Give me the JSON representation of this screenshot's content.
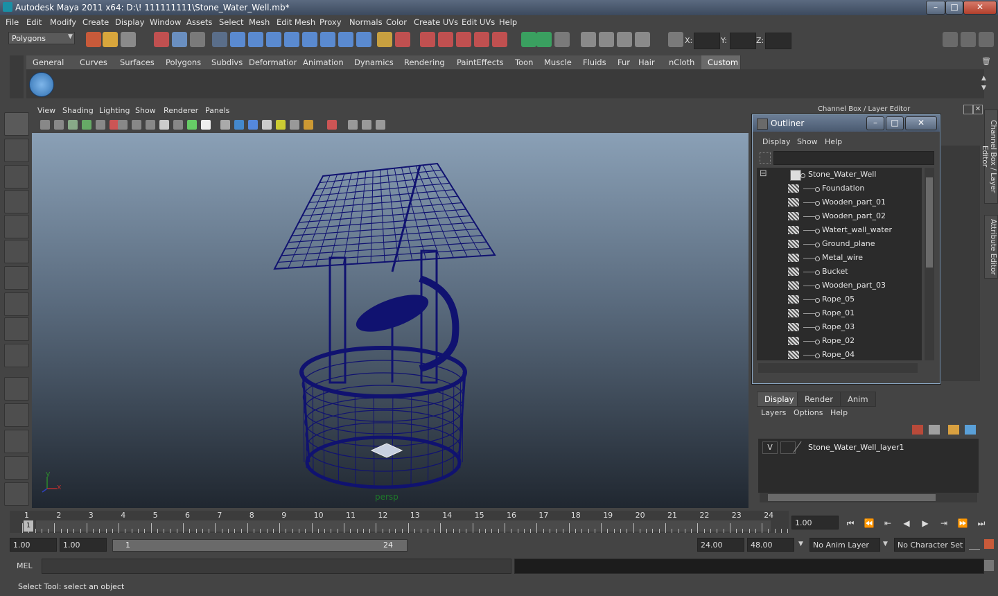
{
  "window": {
    "title": "Autodesk Maya 2011 x64: D:\\! 111111111\\Stone_Water_Well.mb*",
    "minimize": "–",
    "maximize": "□",
    "close": "✕"
  },
  "menubar": [
    "File",
    "Edit",
    "Modify",
    "Create",
    "Display",
    "Window",
    "Assets",
    "Select",
    "Mesh",
    "Edit Mesh",
    "Proxy",
    "Normals",
    "Color",
    "Create UVs",
    "Edit UVs",
    "Help"
  ],
  "toolbar": {
    "mode": "Polygons",
    "x_label": "X:",
    "y_label": "Y:",
    "z_label": "Z:"
  },
  "shelf_tabs": [
    "General",
    "Curves",
    "Surfaces",
    "Polygons",
    "Subdivs",
    "Deformation",
    "Animation",
    "Dynamics",
    "Rendering",
    "PaintEffects",
    "Toon",
    "Muscle",
    "Fluids",
    "Fur",
    "Hair",
    "nCloth",
    "Custom"
  ],
  "shelf_active_tab": "Custom",
  "viewport": {
    "menu": [
      "View",
      "Shading",
      "Lighting",
      "Show",
      "Renderer",
      "Panels"
    ],
    "camera": "persp",
    "axis_y": "y",
    "axis_x": "x",
    "wire_color": "#101270"
  },
  "channel_box_title": "Channel Box / Layer Editor",
  "side_tabs": [
    "Channel Box / Layer Editor",
    "Attribute Editor"
  ],
  "outliner": {
    "title": "Outliner",
    "menu": [
      "Display",
      "Show",
      "Help"
    ],
    "collapse_glyph": "⊟",
    "root": "Stone_Water_Well",
    "items": [
      "Foundation",
      "Wooden_part_01",
      "Wooden_part_02",
      "Watert_wall_water",
      "Ground_plane",
      "Metal_wire",
      "Bucket",
      "Wooden_part_03",
      "Rope_05",
      "Rope_01",
      "Rope_03",
      "Rope_02",
      "Rope_04"
    ]
  },
  "layer_editor": {
    "tabs": [
      "Display",
      "Render",
      "Anim"
    ],
    "active_tab": "Display",
    "menu": [
      "Layers",
      "Options",
      "Help"
    ],
    "visible_flag": "V",
    "layer_name": "Stone_Water_Well_layer1"
  },
  "timeline": {
    "frames": [
      "1",
      "2",
      "3",
      "4",
      "5",
      "6",
      "7",
      "8",
      "9",
      "10",
      "11",
      "12",
      "13",
      "14",
      "15",
      "16",
      "17",
      "18",
      "19",
      "20",
      "21",
      "22",
      "23",
      "24"
    ],
    "current_marker": "1",
    "current_frame": "1.00"
  },
  "playback": [
    "⏮",
    "⏪",
    "⇤",
    "◀",
    "▶",
    "⇥",
    "⏩",
    "⏭"
  ],
  "range": {
    "start": "1.00",
    "anim_start": "1.00",
    "slider_start": "1",
    "slider_end": "24",
    "end": "24.00",
    "anim_end": "48.00",
    "anim_layer": "No Anim Layer",
    "character_set": "No Character Set"
  },
  "command_line": {
    "label": "MEL"
  },
  "status": "Select Tool: select an object"
}
